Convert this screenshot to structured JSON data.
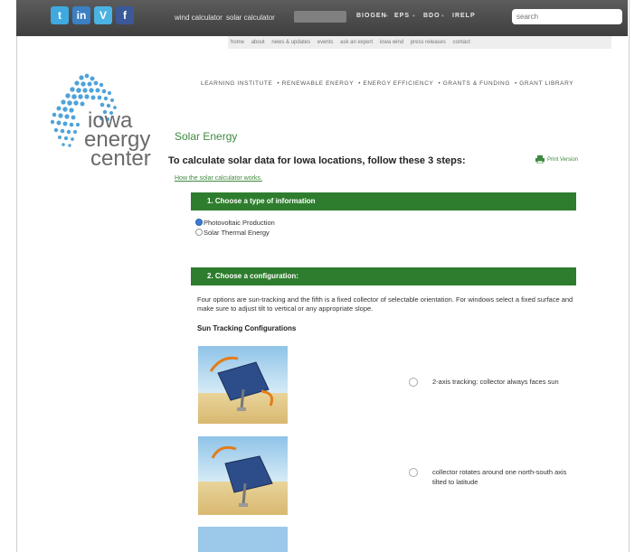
{
  "social_icons": [
    {
      "name": "twitter-icon",
      "glyph": "t",
      "color": "#3fa9e0"
    },
    {
      "name": "linkedin-icon",
      "glyph": "in",
      "color": "#3b7fc4"
    },
    {
      "name": "vimeo-icon",
      "glyph": "V",
      "color": "#4ab3e3"
    },
    {
      "name": "facebook-icon",
      "glyph": "f",
      "color": "#3b5998"
    }
  ],
  "top_links": {
    "wind": "wind calculator",
    "solar": "solar calculator"
  },
  "top_nav": [
    "BIOGEN",
    "EPS",
    "BDO",
    "IRELP"
  ],
  "search": {
    "placeholder": "search"
  },
  "sub_nav": [
    "home",
    "about",
    "news & updates",
    "events",
    "ask an expert",
    "iowa wind",
    "press releases",
    "contact"
  ],
  "logo": {
    "line1": "iowa",
    "line2": "energy",
    "line3": "center"
  },
  "main_nav": [
    "LEARNING INSTITUTE",
    "RENEWABLE ENERGY",
    "ENERGY EFFICIENCY",
    "GRANTS & FUNDING",
    "GRANT LIBRARY"
  ],
  "content": {
    "section_title": "Solar Energy",
    "steps_heading": "To calculate solar data for Iowa locations, follow these 3 steps:",
    "print_version": "Print Version",
    "how_link": "How the solar calculator works.",
    "step1_title": "1. Choose a type of information",
    "step1_options": [
      "Photovoltaic Production",
      "Solar Thermal Energy"
    ],
    "step2_title": "2. Choose a configuration:",
    "step2_desc": "Four options are sun-tracking and the fifth is a fixed collector of selectable orientation. For windows select a fixed surface and make sure to adjust tilt to vertical or any appropriate slope.",
    "sun_tracking_heading": "Sun Tracking Configurations",
    "configs": [
      {
        "label": "2-axis tracking: collector always faces sun"
      },
      {
        "label": "collector rotates around one north-south axis tilted to latitude"
      }
    ]
  },
  "colors": {
    "accent_green": "#2e7d2e",
    "title_green": "#3f8a3f",
    "topbar": "#4a4a4a"
  }
}
